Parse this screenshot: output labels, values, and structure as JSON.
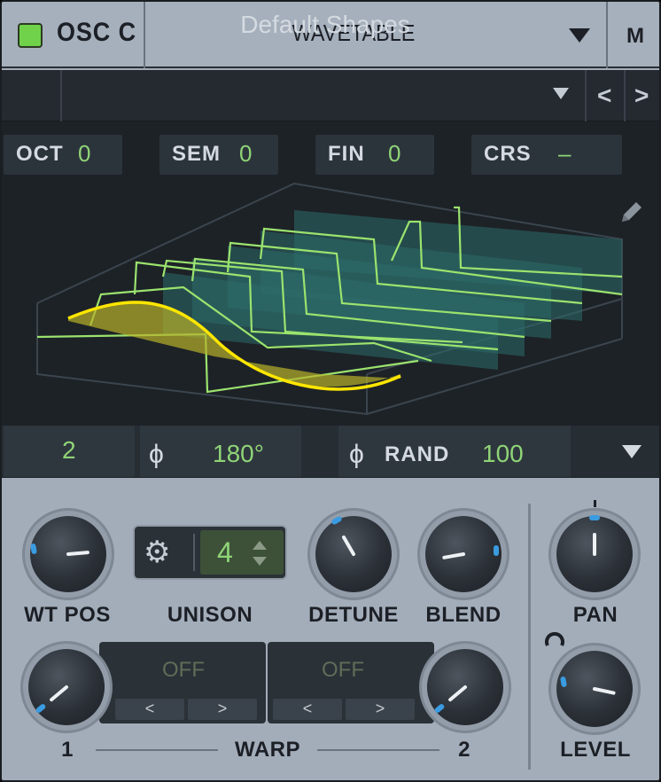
{
  "header": {
    "title": "OSC C",
    "osc_type": "WAVETABLE",
    "mode_button": "M"
  },
  "wavetable": {
    "preset_name": "Default Shapes",
    "prev": "<",
    "next": ">",
    "tuning": [
      {
        "label": "OCT",
        "value": "0"
      },
      {
        "label": "SEM",
        "value": "0"
      },
      {
        "label": "FIN",
        "value": "0"
      },
      {
        "label": "CRS",
        "value": "–"
      }
    ],
    "frame": "2",
    "phase": "180°",
    "phase_icon": "ϕ",
    "rand_label": "RAND",
    "rand_value": "100",
    "phase_rand_icon": "ϕ"
  },
  "controls": {
    "wt_pos_label": "WT POS",
    "unison_label": "UNISON",
    "unison_value": "4",
    "detune_label": "DETUNE",
    "blend_label": "BLEND",
    "pan_label": "PAN",
    "level_label": "LEVEL",
    "warp_label": "WARP",
    "warp1_num": "1",
    "warp2_num": "2",
    "warp1_mode": "OFF",
    "warp2_mode": "OFF",
    "warp_prev": "<",
    "warp_next": ">"
  },
  "colors": {
    "accent_green": "#8fd477",
    "led_green": "#6fd24a",
    "indicator_blue": "#3a9be0",
    "wave_yellow": "#ffe600"
  }
}
